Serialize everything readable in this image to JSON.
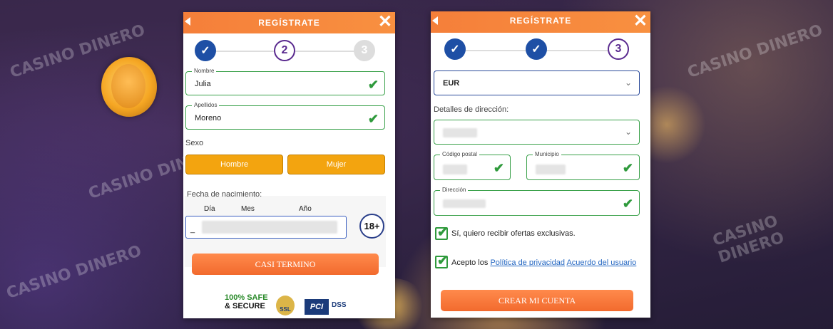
{
  "panel1": {
    "title": "REGÍSTRATE",
    "steps": [
      "✓",
      "2",
      "3"
    ],
    "nombre": {
      "label": "Nombre",
      "value": "Julia"
    },
    "apellidos": {
      "label": "Apellidos",
      "value": "Moreno"
    },
    "sexo_label": "Sexo",
    "gender_options": [
      "Hombre",
      "Mujer"
    ],
    "dob": {
      "label": "Fecha de nacimiento:",
      "day": "Día",
      "month": "Mes",
      "year": "Año",
      "cursor": "_"
    },
    "age_badge": "18+",
    "continue_button": "CASI TERMINO",
    "trust": {
      "safe": "100% SAFE",
      "secure": "& SECURE",
      "ssl": "SSL",
      "pci": "PCI",
      "dss": "DSS"
    }
  },
  "panel2": {
    "title": "REGÍSTRATE",
    "steps": [
      "✓",
      "✓",
      "3"
    ],
    "currency": "EUR",
    "address_section_label": "Detalles de dirección:",
    "codigo_postal": {
      "label": "Código postal"
    },
    "municipio": {
      "label": "Municipio"
    },
    "direccion": {
      "label": "Dirección"
    },
    "offers_checkbox": "Sí, quiero recibir ofertas exclusivas.",
    "terms": {
      "prefix": "Acepto los",
      "privacy_link": "Política de privacidad",
      "user_agreement_link": "Acuerdo del usuario"
    },
    "create_button": "CREAR MI CUENTA"
  },
  "watermark": "CASINO DINERO",
  "colors": {
    "header": "#f57f3a",
    "step_done": "#1e4fa5",
    "accent_gender": "#f3a40f",
    "valid": "#2f9a3c"
  }
}
